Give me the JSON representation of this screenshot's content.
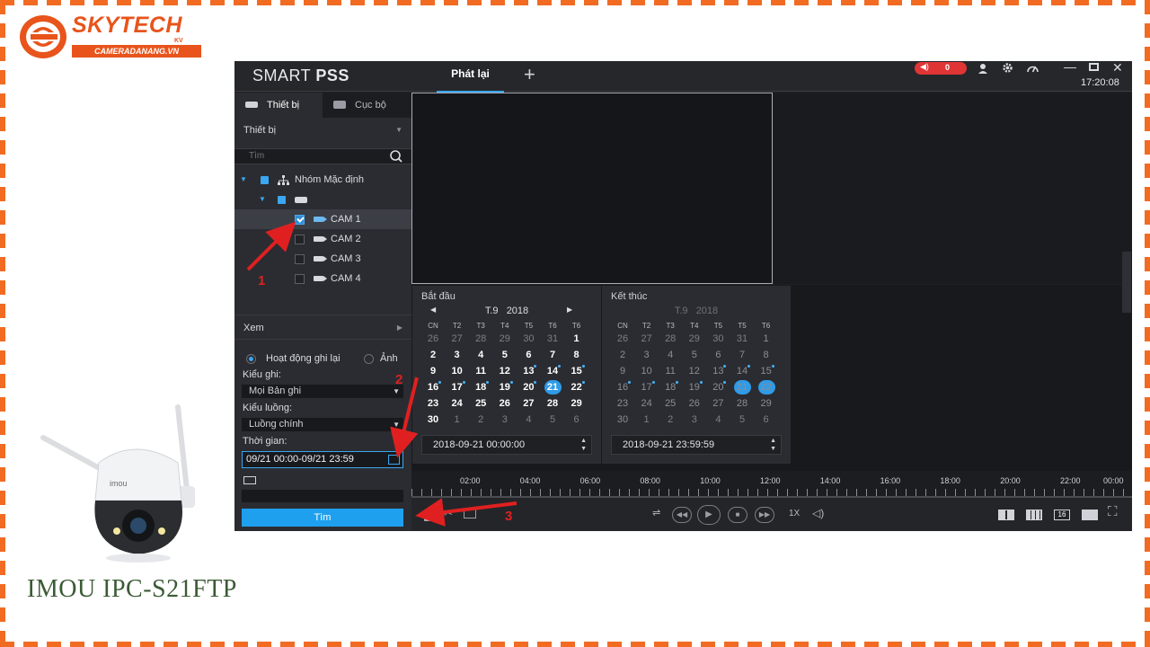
{
  "logo": {
    "name": "SKYTECH",
    "suffix": "KV",
    "url": "CAMERADANANG.VN"
  },
  "product_title": "IMOU IPC-S21FTP",
  "camera_brand": "imou",
  "app": {
    "brand_light": "SMART ",
    "brand_bold": "PSS",
    "active_tab": "Phát lại",
    "add_tab": "+",
    "alarm_count": "0",
    "clock": "17:20:08",
    "titlebar_icons": [
      "user-icon",
      "gear-icon",
      "gauge-icon",
      "minimize-icon",
      "maximize-icon",
      "close-icon"
    ]
  },
  "left_panel": {
    "tabs": [
      {
        "label": "Thiết bị"
      },
      {
        "label": "Cục bộ"
      }
    ],
    "device_header": "Thiết bị",
    "search_placeholder": "Tìm",
    "group_label": "Nhóm Mặc định",
    "cameras": [
      {
        "label": "CAM 1",
        "checked": true
      },
      {
        "label": "CAM 2",
        "checked": false
      },
      {
        "label": "CAM 3",
        "checked": false
      },
      {
        "label": "CAM 4",
        "checked": false
      }
    ],
    "view_header": "Xem",
    "radio_record": "Hoạt động ghi lại",
    "radio_image": "Ảnh",
    "record_type_label": "Kiểu ghi:",
    "record_type_value": "Mọi Bản ghi",
    "stream_label": "Kiểu luồng:",
    "stream_value": "Luồng chính",
    "time_label": "Thời gian:",
    "time_value": "09/21 00:00-09/21 23:59",
    "search_button": "Tìm"
  },
  "calendar_start": {
    "title": "Bắt đầu",
    "month": "T.9",
    "year": "2018",
    "weekdays": [
      "CN",
      "T2",
      "T3",
      "T4",
      "T5",
      "T6",
      "T6"
    ],
    "weeks": [
      [
        "26",
        "27",
        "28",
        "29",
        "30",
        "31",
        "1"
      ],
      [
        "2",
        "3",
        "4",
        "5",
        "6",
        "7",
        "8"
      ],
      [
        "9",
        "10",
        "11",
        "12",
        "13",
        "14",
        "15"
      ],
      [
        "16",
        "17",
        "18",
        "19",
        "20",
        "21",
        "22"
      ],
      [
        "23",
        "24",
        "25",
        "26",
        "27",
        "28",
        "29"
      ],
      [
        "30",
        "1",
        "2",
        "3",
        "4",
        "5",
        "6"
      ]
    ],
    "datetime": "2018-09-21 00:00:00"
  },
  "calendar_end": {
    "title": "Kết thúc",
    "month": "T.9",
    "year": "2018",
    "weekdays": [
      "CN",
      "T2",
      "T3",
      "T4",
      "T5",
      "T5",
      "T6"
    ],
    "weeks": [
      [
        "26",
        "27",
        "28",
        "29",
        "30",
        "31",
        "1"
      ],
      [
        "2",
        "3",
        "4",
        "5",
        "6",
        "7",
        "8"
      ],
      [
        "9",
        "10",
        "11",
        "12",
        "13",
        "14",
        "15"
      ],
      [
        "16",
        "17",
        "18",
        "19",
        "20",
        "21",
        "22"
      ],
      [
        "23",
        "24",
        "25",
        "26",
        "27",
        "28",
        "29"
      ],
      [
        "30",
        "1",
        "2",
        "3",
        "4",
        "5",
        "6"
      ]
    ],
    "datetime": "2018-09-21 23:59:59"
  },
  "timeline_labels": [
    "02:00",
    "04:00",
    "06:00",
    "08:00",
    "10:00",
    "12:00",
    "14:00",
    "16:00",
    "18:00",
    "20:00",
    "22:00",
    "00:00"
  ],
  "controls": {
    "speed": "1X",
    "layout_16": "16"
  },
  "steps": [
    "1",
    "2",
    "3"
  ],
  "colors": {
    "accent": "#3aa7f0",
    "brand_orange": "#e8541b",
    "annotation_red": "#e02020",
    "alarm_red": "#e03535"
  }
}
